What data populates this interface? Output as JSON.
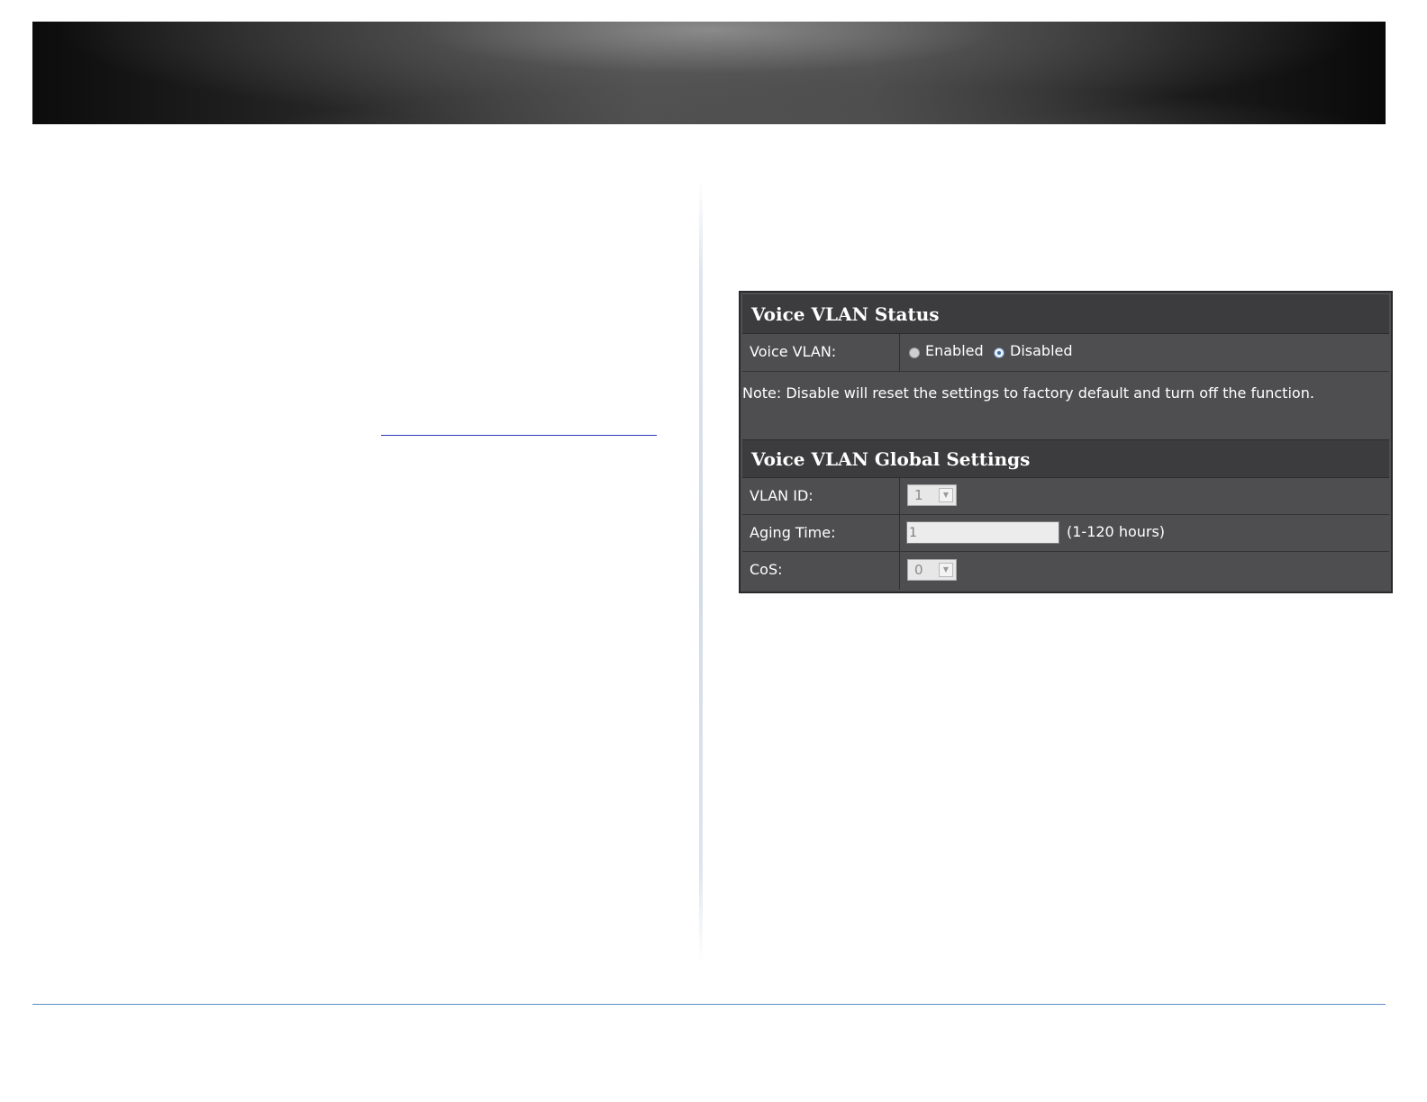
{
  "status_section": {
    "title": "Voice VLAN Status",
    "voice_vlan_label": "Voice VLAN:",
    "options": [
      {
        "label": "Enabled",
        "selected": false
      },
      {
        "label": "Disabled",
        "selected": true
      }
    ],
    "note": "Note: Disable will reset the settings to factory default and turn off the function."
  },
  "global_section": {
    "title": "Voice VLAN Global Settings",
    "vlan_id": {
      "label": "VLAN ID:",
      "value": "1"
    },
    "aging_time": {
      "label": "Aging Time:",
      "value": "1",
      "range": "(1-120 hours)"
    },
    "cos": {
      "label": "CoS:",
      "value": "0"
    }
  },
  "icons": {
    "dropdown": "chevron-down-icon"
  }
}
